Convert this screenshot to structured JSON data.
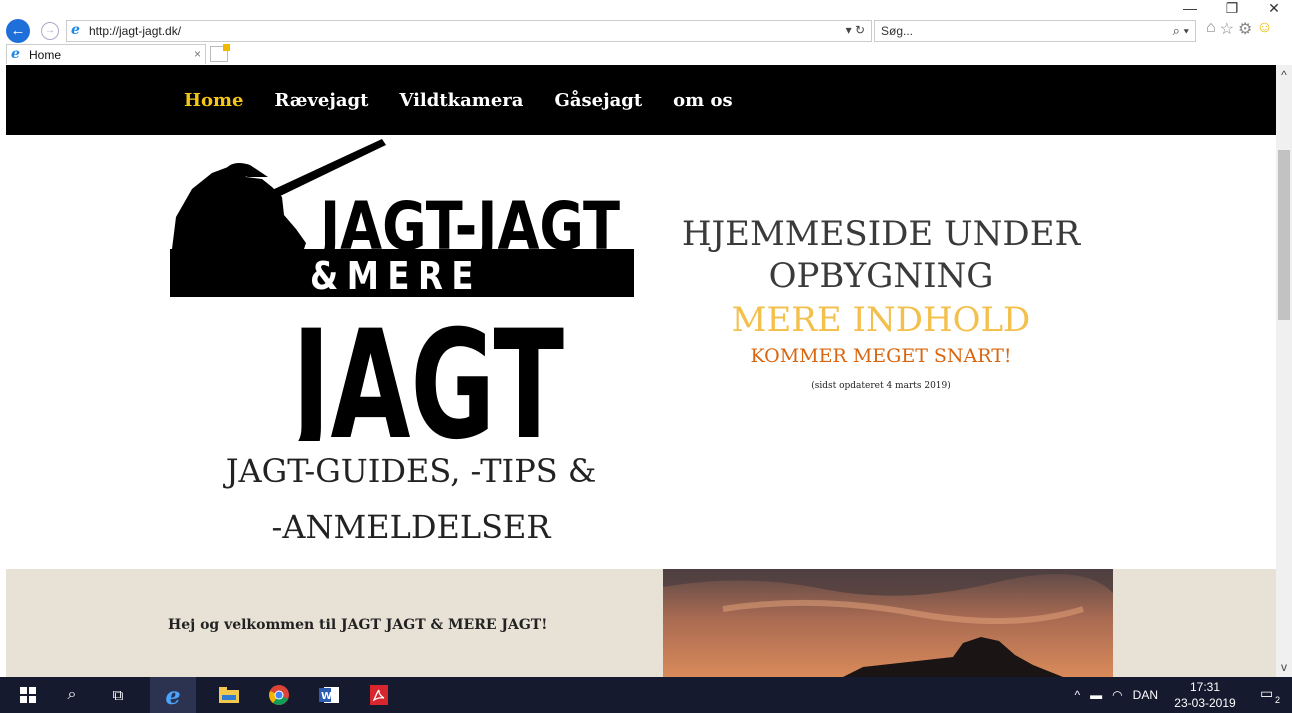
{
  "browser": {
    "url": "http://jagt-jagt.dk/",
    "search_placeholder": "Søg...",
    "tab_title": "Home",
    "window_controls": [
      "—",
      "❐",
      "✕"
    ]
  },
  "site": {
    "nav": [
      {
        "label": "Home",
        "active": true
      },
      {
        "label": "Rævejagt",
        "active": false
      },
      {
        "label": "Vildtkamera",
        "active": false
      },
      {
        "label": "Gåsejagt",
        "active": false
      },
      {
        "label": "om os",
        "active": false
      }
    ],
    "logo": {
      "line1": "JAGT-JAGT",
      "line2": "&MERE",
      "line3": "JAGT"
    },
    "tagline": {
      "line1": "JAGT-GUIDES, -TIPS &",
      "line2": "-ANMELDELSER"
    },
    "construction": {
      "line1": "HJEMMESIDE UNDER",
      "line1b": "OPBYGNING",
      "line2": "MERE INDHOLD",
      "line3": "KOMMER MEGET SNART!",
      "line4": "(sidst opdateret 4 marts 2019)"
    },
    "welcome": "Hej og velkommen til JAGT JAGT & MERE JAGT!"
  },
  "taskbar": {
    "language": "DAN",
    "time": "17:31",
    "date": "23-03-2019",
    "notification_count": "2"
  },
  "colors": {
    "nav_bg": "#000000",
    "nav_active": "#f5c518",
    "band_bg": "#e8e1d6",
    "accent_yellow": "#f3c04d",
    "accent_orange": "#d9660f"
  }
}
